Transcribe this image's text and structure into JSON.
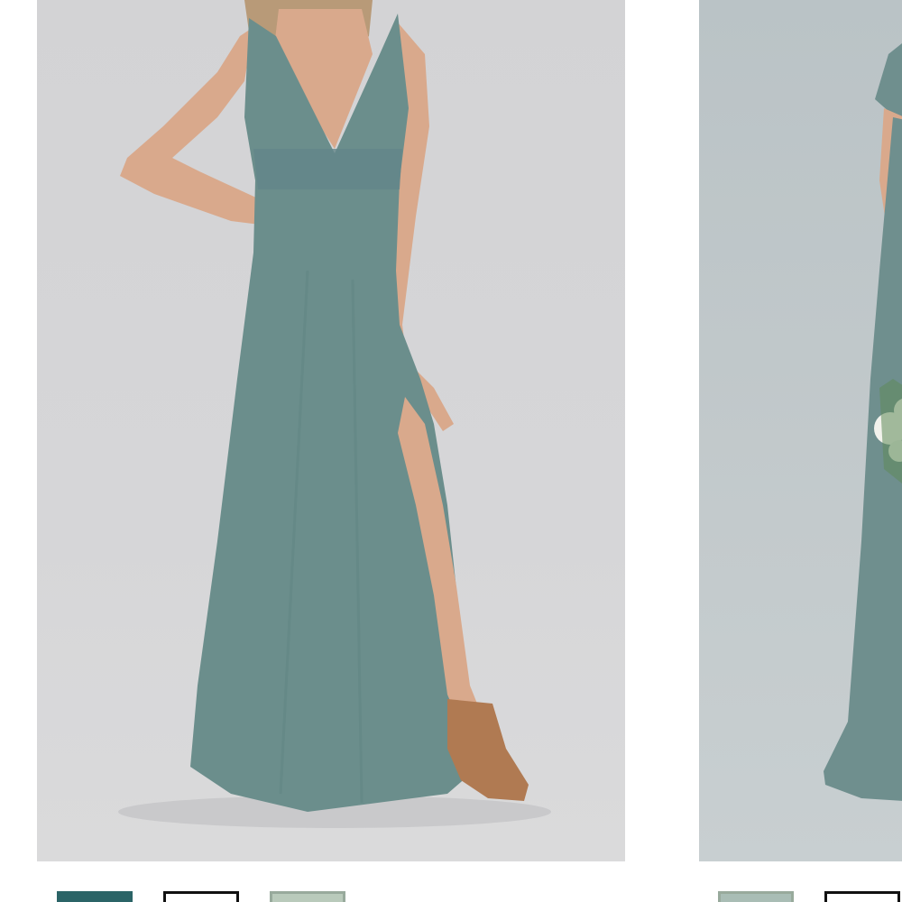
{
  "products": [
    {
      "image": {
        "subject": "dress",
        "colors": {
          "background": "#d5d5d7",
          "dress": "#6b8e8c",
          "skin": "#d9a98c",
          "hair": "#b89a78",
          "shoe": "#b07a52"
        }
      },
      "swatches": [
        {
          "color": "#2b6467",
          "selected": false
        },
        {
          "color": "#ffffff",
          "selected": true
        },
        {
          "color": "#b9cabb",
          "selected": false
        }
      ]
    },
    {
      "image": {
        "subject": "dress",
        "colors": {
          "background": "#c1c9cb",
          "dress": "#6f8f8e",
          "skin": "#d9a98c",
          "bouquet": "#f2f2ec"
        }
      },
      "swatches": [
        {
          "color": "#a9bdb5",
          "selected": false
        },
        {
          "color": "#ffffff",
          "selected": true
        }
      ]
    }
  ]
}
